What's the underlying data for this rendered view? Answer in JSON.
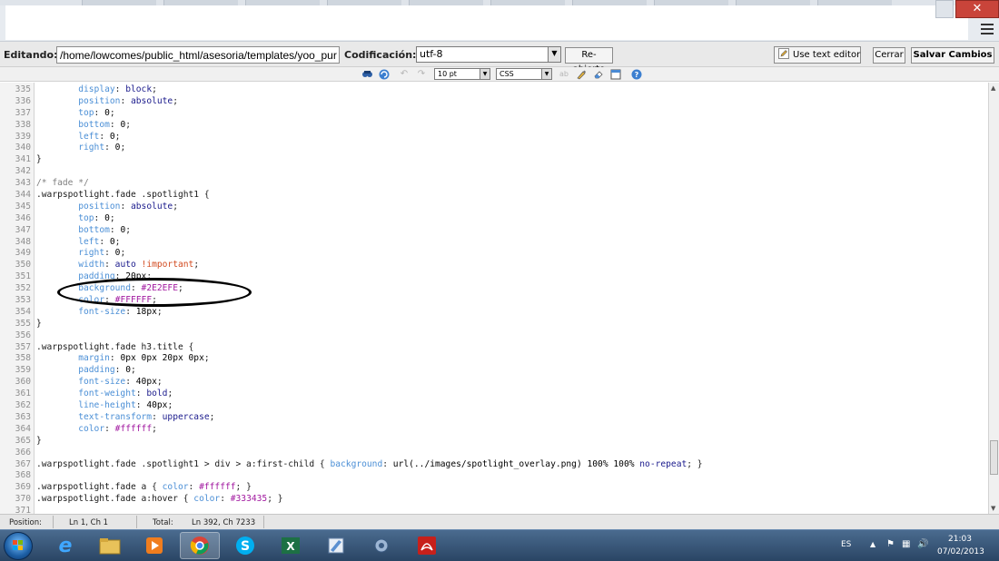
{
  "editor": {
    "edit_label": "Editando:",
    "path": "/home/lowcomes/public_html/asesoria/templates/yoo_pur",
    "encoding_label": "Codificación:",
    "encoding_value": "utf-8",
    "reopen_label": "Re-abierto",
    "text_editor_label": "Use text editor",
    "close_label": "Cerrar",
    "save_label": "Salvar Cambios"
  },
  "toolbar": {
    "font_size": "10 pt",
    "syntax": "CSS"
  },
  "code": {
    "lines": [
      {
        "n": "335",
        "t": [
          {
            "s": "        "
          },
          {
            "s": "display",
            "c": "c-prop"
          },
          {
            "s": ": ",
            "c": "c-plain"
          },
          {
            "s": "block",
            "c": "c-val"
          },
          {
            "s": ";",
            "c": "c-plain"
          }
        ]
      },
      {
        "n": "336",
        "t": [
          {
            "s": "        "
          },
          {
            "s": "position",
            "c": "c-prop"
          },
          {
            "s": ": ",
            "c": "c-plain"
          },
          {
            "s": "absolute",
            "c": "c-val"
          },
          {
            "s": ";",
            "c": "c-plain"
          }
        ]
      },
      {
        "n": "337",
        "t": [
          {
            "s": "        "
          },
          {
            "s": "top",
            "c": "c-prop"
          },
          {
            "s": ": ",
            "c": "c-plain"
          },
          {
            "s": "0",
            "c": "c-num"
          },
          {
            "s": ";",
            "c": "c-plain"
          }
        ]
      },
      {
        "n": "338",
        "t": [
          {
            "s": "        "
          },
          {
            "s": "bottom",
            "c": "c-prop"
          },
          {
            "s": ": ",
            "c": "c-plain"
          },
          {
            "s": "0",
            "c": "c-num"
          },
          {
            "s": ";",
            "c": "c-plain"
          }
        ]
      },
      {
        "n": "339",
        "t": [
          {
            "s": "        "
          },
          {
            "s": "left",
            "c": "c-prop"
          },
          {
            "s": ": ",
            "c": "c-plain"
          },
          {
            "s": "0",
            "c": "c-num"
          },
          {
            "s": ";",
            "c": "c-plain"
          }
        ]
      },
      {
        "n": "340",
        "t": [
          {
            "s": "        "
          },
          {
            "s": "right",
            "c": "c-prop"
          },
          {
            "s": ": ",
            "c": "c-plain"
          },
          {
            "s": "0",
            "c": "c-num"
          },
          {
            "s": ";",
            "c": "c-plain"
          }
        ]
      },
      {
        "n": "341",
        "t": [
          {
            "s": "}",
            "c": "c-sel"
          }
        ]
      },
      {
        "n": "342",
        "t": []
      },
      {
        "n": "343",
        "t": [
          {
            "s": "/* fade */",
            "c": "c-com"
          }
        ]
      },
      {
        "n": "344",
        "t": [
          {
            "s": ".warpspotlight.fade .spotlight1 ",
            "c": "c-sel"
          },
          {
            "s": "{",
            "c": "c-plain"
          }
        ]
      },
      {
        "n": "345",
        "t": [
          {
            "s": "        "
          },
          {
            "s": "position",
            "c": "c-prop"
          },
          {
            "s": ": ",
            "c": "c-plain"
          },
          {
            "s": "absolute",
            "c": "c-val"
          },
          {
            "s": ";",
            "c": "c-plain"
          }
        ]
      },
      {
        "n": "346",
        "t": [
          {
            "s": "        "
          },
          {
            "s": "top",
            "c": "c-prop"
          },
          {
            "s": ": ",
            "c": "c-plain"
          },
          {
            "s": "0",
            "c": "c-num"
          },
          {
            "s": ";",
            "c": "c-plain"
          }
        ]
      },
      {
        "n": "347",
        "t": [
          {
            "s": "        "
          },
          {
            "s": "bottom",
            "c": "c-prop"
          },
          {
            "s": ": ",
            "c": "c-plain"
          },
          {
            "s": "0",
            "c": "c-num"
          },
          {
            "s": ";",
            "c": "c-plain"
          }
        ]
      },
      {
        "n": "348",
        "t": [
          {
            "s": "        "
          },
          {
            "s": "left",
            "c": "c-prop"
          },
          {
            "s": ": ",
            "c": "c-plain"
          },
          {
            "s": "0",
            "c": "c-num"
          },
          {
            "s": ";",
            "c": "c-plain"
          }
        ]
      },
      {
        "n": "349",
        "t": [
          {
            "s": "        "
          },
          {
            "s": "right",
            "c": "c-prop"
          },
          {
            "s": ": ",
            "c": "c-plain"
          },
          {
            "s": "0",
            "c": "c-num"
          },
          {
            "s": ";",
            "c": "c-plain"
          }
        ]
      },
      {
        "n": "350",
        "t": [
          {
            "s": "        "
          },
          {
            "s": "width",
            "c": "c-prop"
          },
          {
            "s": ": ",
            "c": "c-plain"
          },
          {
            "s": "auto",
            "c": "c-val"
          },
          {
            "s": " !important",
            "c": "c-imp"
          },
          {
            "s": ";",
            "c": "c-plain"
          }
        ]
      },
      {
        "n": "351",
        "t": [
          {
            "s": "        "
          },
          {
            "s": "padding",
            "c": "c-prop"
          },
          {
            "s": ": ",
            "c": "c-plain"
          },
          {
            "s": "20px",
            "c": "c-num"
          },
          {
            "s": ";",
            "c": "c-plain"
          }
        ]
      },
      {
        "n": "352",
        "t": [
          {
            "s": "        "
          },
          {
            "s": "background",
            "c": "c-prop"
          },
          {
            "s": ": ",
            "c": "c-plain"
          },
          {
            "s": "#2E2EFE",
            "c": "c-str"
          },
          {
            "s": ";",
            "c": "c-plain"
          }
        ]
      },
      {
        "n": "353",
        "t": [
          {
            "s": "        "
          },
          {
            "s": "color",
            "c": "c-prop"
          },
          {
            "s": ": ",
            "c": "c-plain"
          },
          {
            "s": "#FFFFFF",
            "c": "c-str"
          },
          {
            "s": ";",
            "c": "c-plain"
          }
        ]
      },
      {
        "n": "354",
        "t": [
          {
            "s": "        "
          },
          {
            "s": "font-size",
            "c": "c-prop"
          },
          {
            "s": ": ",
            "c": "c-plain"
          },
          {
            "s": "18px",
            "c": "c-num"
          },
          {
            "s": ";",
            "c": "c-plain"
          }
        ]
      },
      {
        "n": "355",
        "t": [
          {
            "s": "}",
            "c": "c-sel"
          }
        ]
      },
      {
        "n": "356",
        "t": []
      },
      {
        "n": "357",
        "t": [
          {
            "s": ".warpspotlight.fade h3.title ",
            "c": "c-sel"
          },
          {
            "s": "{",
            "c": "c-plain"
          }
        ]
      },
      {
        "n": "358",
        "t": [
          {
            "s": "        "
          },
          {
            "s": "margin",
            "c": "c-prop"
          },
          {
            "s": ": ",
            "c": "c-plain"
          },
          {
            "s": "0px 0px 20px 0px",
            "c": "c-num"
          },
          {
            "s": ";",
            "c": "c-plain"
          }
        ]
      },
      {
        "n": "359",
        "t": [
          {
            "s": "        "
          },
          {
            "s": "padding",
            "c": "c-prop"
          },
          {
            "s": ": ",
            "c": "c-plain"
          },
          {
            "s": "0",
            "c": "c-num"
          },
          {
            "s": ";",
            "c": "c-plain"
          }
        ]
      },
      {
        "n": "360",
        "t": [
          {
            "s": "        "
          },
          {
            "s": "font-size",
            "c": "c-prop"
          },
          {
            "s": ": ",
            "c": "c-plain"
          },
          {
            "s": "40px",
            "c": "c-num"
          },
          {
            "s": ";",
            "c": "c-plain"
          }
        ]
      },
      {
        "n": "361",
        "t": [
          {
            "s": "        "
          },
          {
            "s": "font-weight",
            "c": "c-prop"
          },
          {
            "s": ": ",
            "c": "c-plain"
          },
          {
            "s": "bold",
            "c": "c-val"
          },
          {
            "s": ";",
            "c": "c-plain"
          }
        ]
      },
      {
        "n": "362",
        "t": [
          {
            "s": "        "
          },
          {
            "s": "line-height",
            "c": "c-prop"
          },
          {
            "s": ": ",
            "c": "c-plain"
          },
          {
            "s": "40px",
            "c": "c-num"
          },
          {
            "s": ";",
            "c": "c-plain"
          }
        ]
      },
      {
        "n": "363",
        "t": [
          {
            "s": "        "
          },
          {
            "s": "text-transform",
            "c": "c-prop"
          },
          {
            "s": ": ",
            "c": "c-plain"
          },
          {
            "s": "uppercase",
            "c": "c-val"
          },
          {
            "s": ";",
            "c": "c-plain"
          }
        ]
      },
      {
        "n": "364",
        "t": [
          {
            "s": "        "
          },
          {
            "s": "color",
            "c": "c-prop"
          },
          {
            "s": ": ",
            "c": "c-plain"
          },
          {
            "s": "#ffffff",
            "c": "c-str"
          },
          {
            "s": ";",
            "c": "c-plain"
          }
        ]
      },
      {
        "n": "365",
        "t": [
          {
            "s": "}",
            "c": "c-sel"
          }
        ]
      },
      {
        "n": "366",
        "t": []
      },
      {
        "n": "367",
        "t": [
          {
            "s": ".warpspotlight.fade .spotlight1 > div > a:first-child ",
            "c": "c-sel"
          },
          {
            "s": "{ ",
            "c": "c-plain"
          },
          {
            "s": "background",
            "c": "c-prop"
          },
          {
            "s": ": ",
            "c": "c-plain"
          },
          {
            "s": "url(../images/spotlight_overlay.png) 100% 100% ",
            "c": "c-num"
          },
          {
            "s": "no-repeat",
            "c": "c-val"
          },
          {
            "s": "; }",
            "c": "c-plain"
          }
        ]
      },
      {
        "n": "368",
        "t": []
      },
      {
        "n": "369",
        "t": [
          {
            "s": ".warpspotlight.fade a ",
            "c": "c-sel"
          },
          {
            "s": "{ ",
            "c": "c-plain"
          },
          {
            "s": "color",
            "c": "c-prop"
          },
          {
            "s": ": ",
            "c": "c-plain"
          },
          {
            "s": "#ffffff",
            "c": "c-str"
          },
          {
            "s": "; }",
            "c": "c-plain"
          }
        ]
      },
      {
        "n": "370",
        "t": [
          {
            "s": ".warpspotlight.fade a:hover ",
            "c": "c-sel"
          },
          {
            "s": "{ ",
            "c": "c-plain"
          },
          {
            "s": "color",
            "c": "c-prop"
          },
          {
            "s": ": ",
            "c": "c-plain"
          },
          {
            "s": "#333435",
            "c": "c-str"
          },
          {
            "s": "; }",
            "c": "c-plain"
          }
        ]
      },
      {
        "n": "371",
        "t": []
      }
    ]
  },
  "status": {
    "position_label": "Position:",
    "position_value": "Ln 1, Ch 1",
    "total_label": "Total:",
    "total_value": "Ln 392, Ch 7233"
  },
  "taskbar": {
    "language": "ES",
    "time": "21:03",
    "date": "07/02/2013"
  },
  "colors": {
    "close_button": "#c9443a",
    "property": "#4b8fd6",
    "value_keyword": "#1a1a8c",
    "hex_color": "#a21aa0",
    "important": "#d24a1f"
  },
  "icons": [
    "search-icon",
    "refresh-icon",
    "undo-icon",
    "redo-icon",
    "spellcheck-icon",
    "clean-icon",
    "eraser-icon",
    "fullscreen-icon",
    "help-icon",
    "pencil-icon",
    "menu-icon"
  ]
}
